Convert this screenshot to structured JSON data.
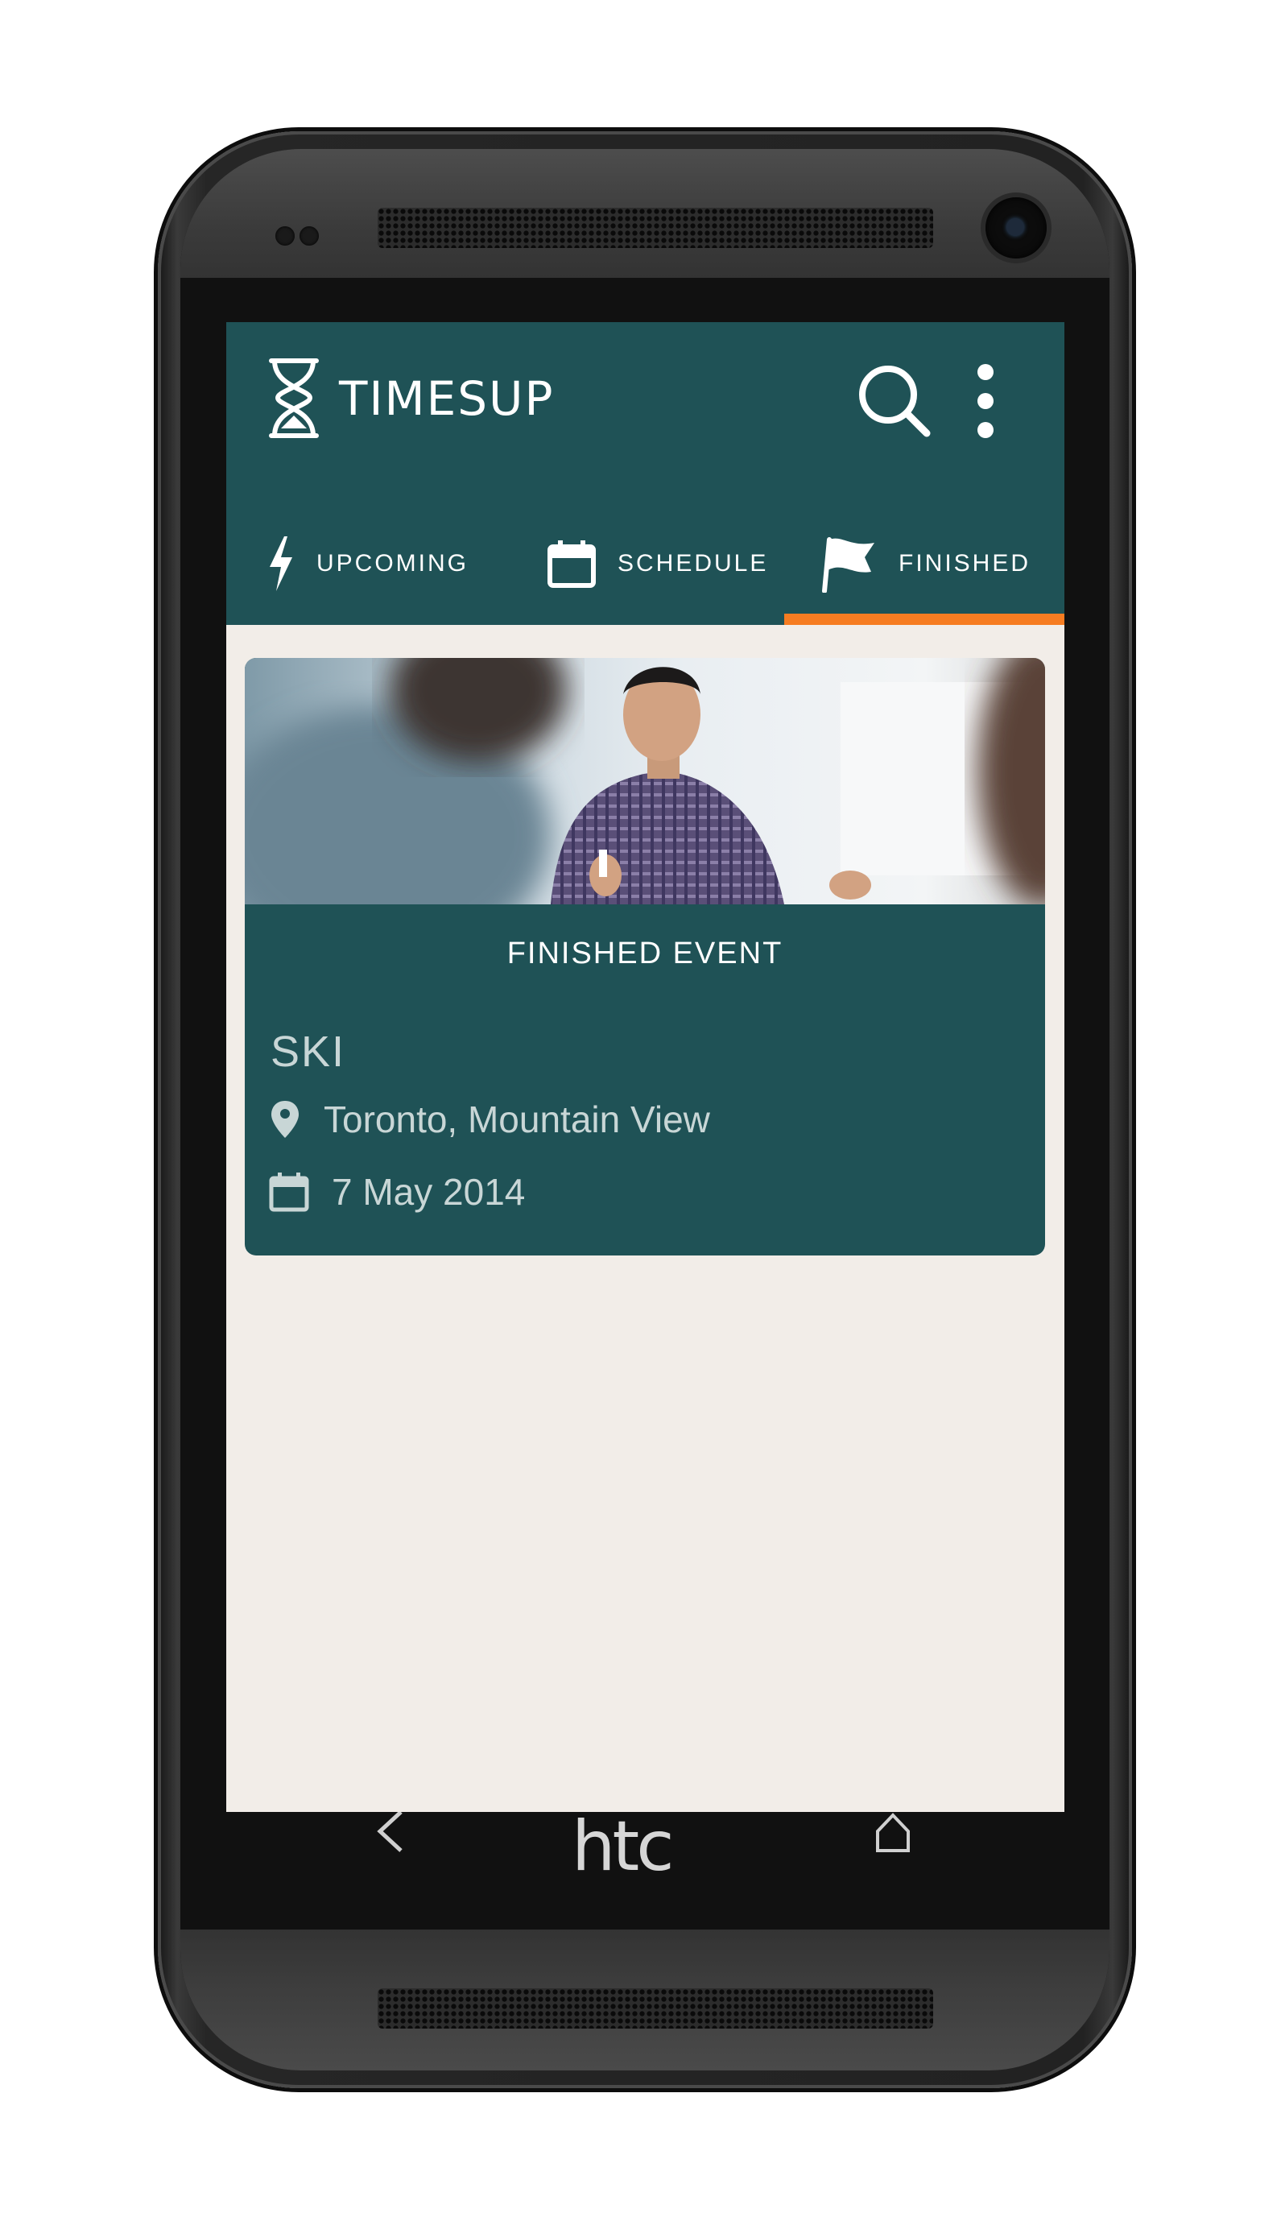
{
  "app": {
    "name": "TIMESUP",
    "colors": {
      "primary": "#1f5256",
      "accent": "#f67c21",
      "background": "#f2ede8"
    }
  },
  "toolbar": {
    "search_icon": "search-icon",
    "menu_icon": "overflow-menu-icon"
  },
  "tabs": [
    {
      "label": "UPCOMING",
      "icon": "lightning-icon",
      "selected": false
    },
    {
      "label": "SCHEDULE",
      "icon": "calendar-icon",
      "selected": false
    },
    {
      "label": "FINISHED",
      "icon": "flag-icon",
      "selected": true
    }
  ],
  "event_card": {
    "heading": "FINISHED EVENT",
    "title": "SKI",
    "location": "Toronto, Mountain View",
    "date": "7 May 2014"
  },
  "device": {
    "brand": "htc"
  }
}
